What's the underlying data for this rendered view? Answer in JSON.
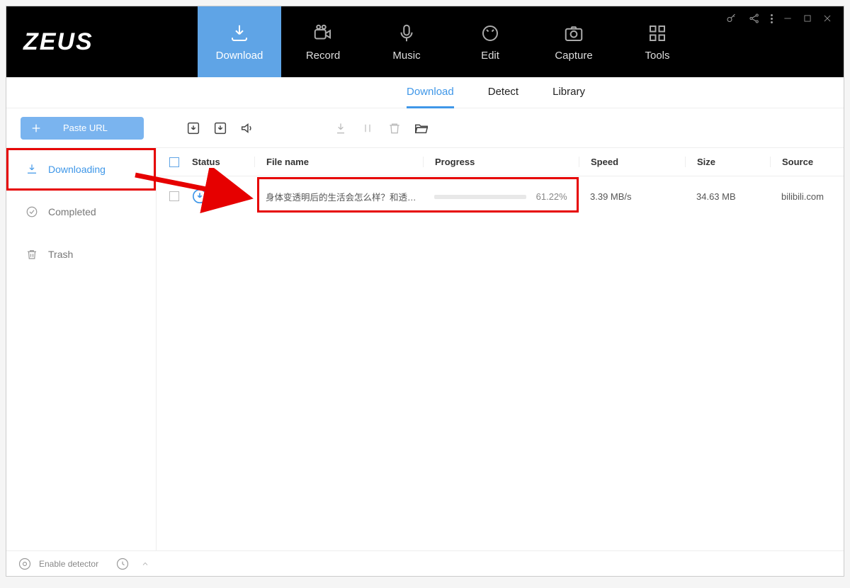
{
  "app": {
    "title": "ZEUS"
  },
  "nav": [
    {
      "label": "Download",
      "active": true
    },
    {
      "label": "Record"
    },
    {
      "label": "Music"
    },
    {
      "label": "Edit"
    },
    {
      "label": "Capture"
    },
    {
      "label": "Tools"
    }
  ],
  "subtabs": [
    {
      "label": "Download",
      "active": true
    },
    {
      "label": "Detect"
    },
    {
      "label": "Library"
    }
  ],
  "toolbar": {
    "paste_url": "Paste URL"
  },
  "sidebar": [
    {
      "label": "Downloading",
      "active": true
    },
    {
      "label": "Completed"
    },
    {
      "label": "Trash"
    }
  ],
  "columns": {
    "status": "Status",
    "file": "File name",
    "progress": "Progress",
    "speed": "Speed",
    "size": "Size",
    "source": "Source"
  },
  "rows": [
    {
      "file": "身体变透明后的生活会怎么样？和透明...",
      "progress_pct": "61.22%",
      "speed": "3.39 MB/s",
      "size": "34.63 MB",
      "source": "bilibili.com"
    }
  ],
  "footer": {
    "detector": "Enable detector"
  }
}
